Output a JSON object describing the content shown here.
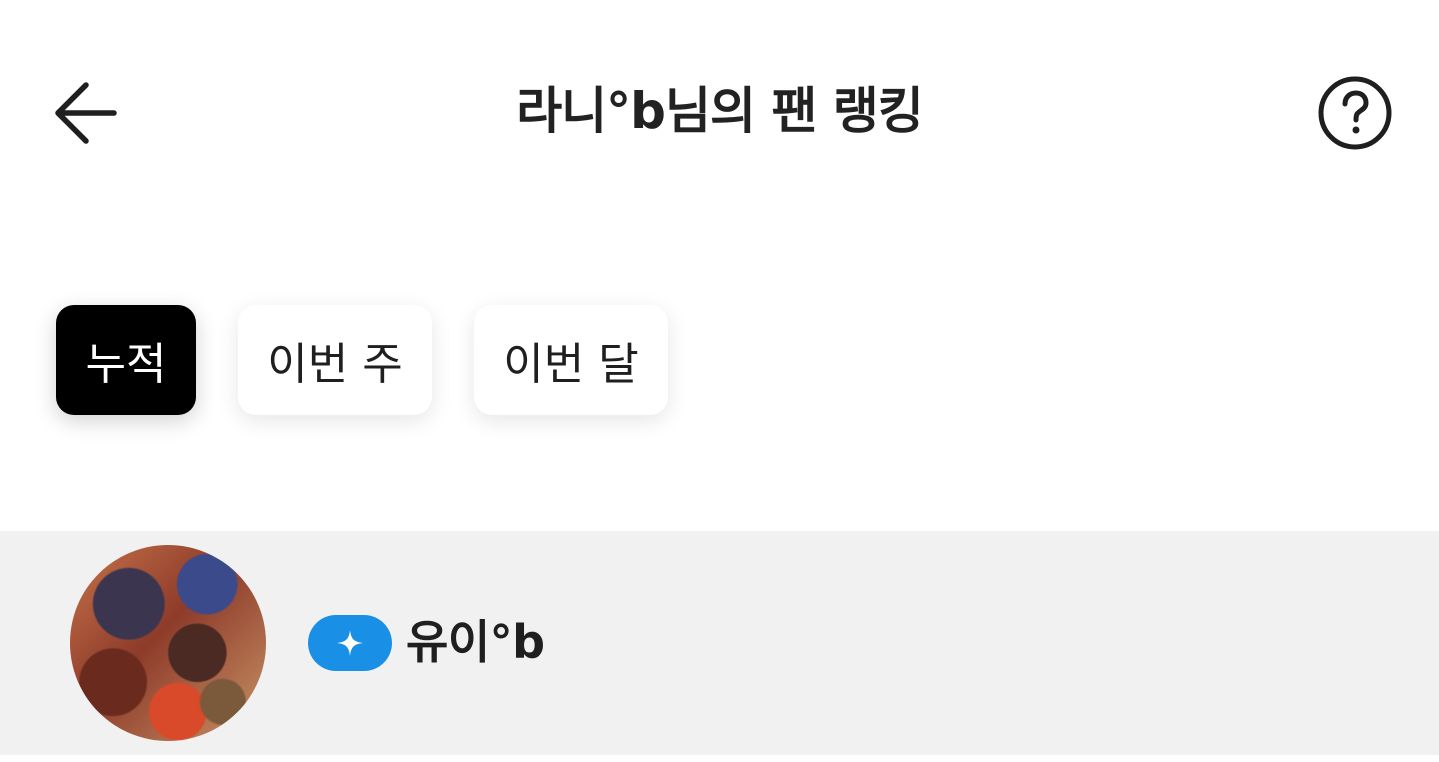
{
  "header": {
    "title": "라니°b님의 팬 랭킹",
    "back_icon": "arrow-left-icon",
    "help_icon": "question-circle-icon"
  },
  "filters": {
    "tabs": [
      {
        "label": "누적",
        "selected": true
      },
      {
        "label": "이번 주",
        "selected": false
      },
      {
        "label": "이번 달",
        "selected": false
      }
    ]
  },
  "ranking": {
    "items": [
      {
        "name": "유이°b",
        "badge_icon": "sparkle-icon",
        "badge_color": "#1a8fe6"
      }
    ]
  },
  "colors": {
    "active_chip": "#000000",
    "list_background": "#f1f1f1",
    "badge": "#1a8fe6"
  }
}
